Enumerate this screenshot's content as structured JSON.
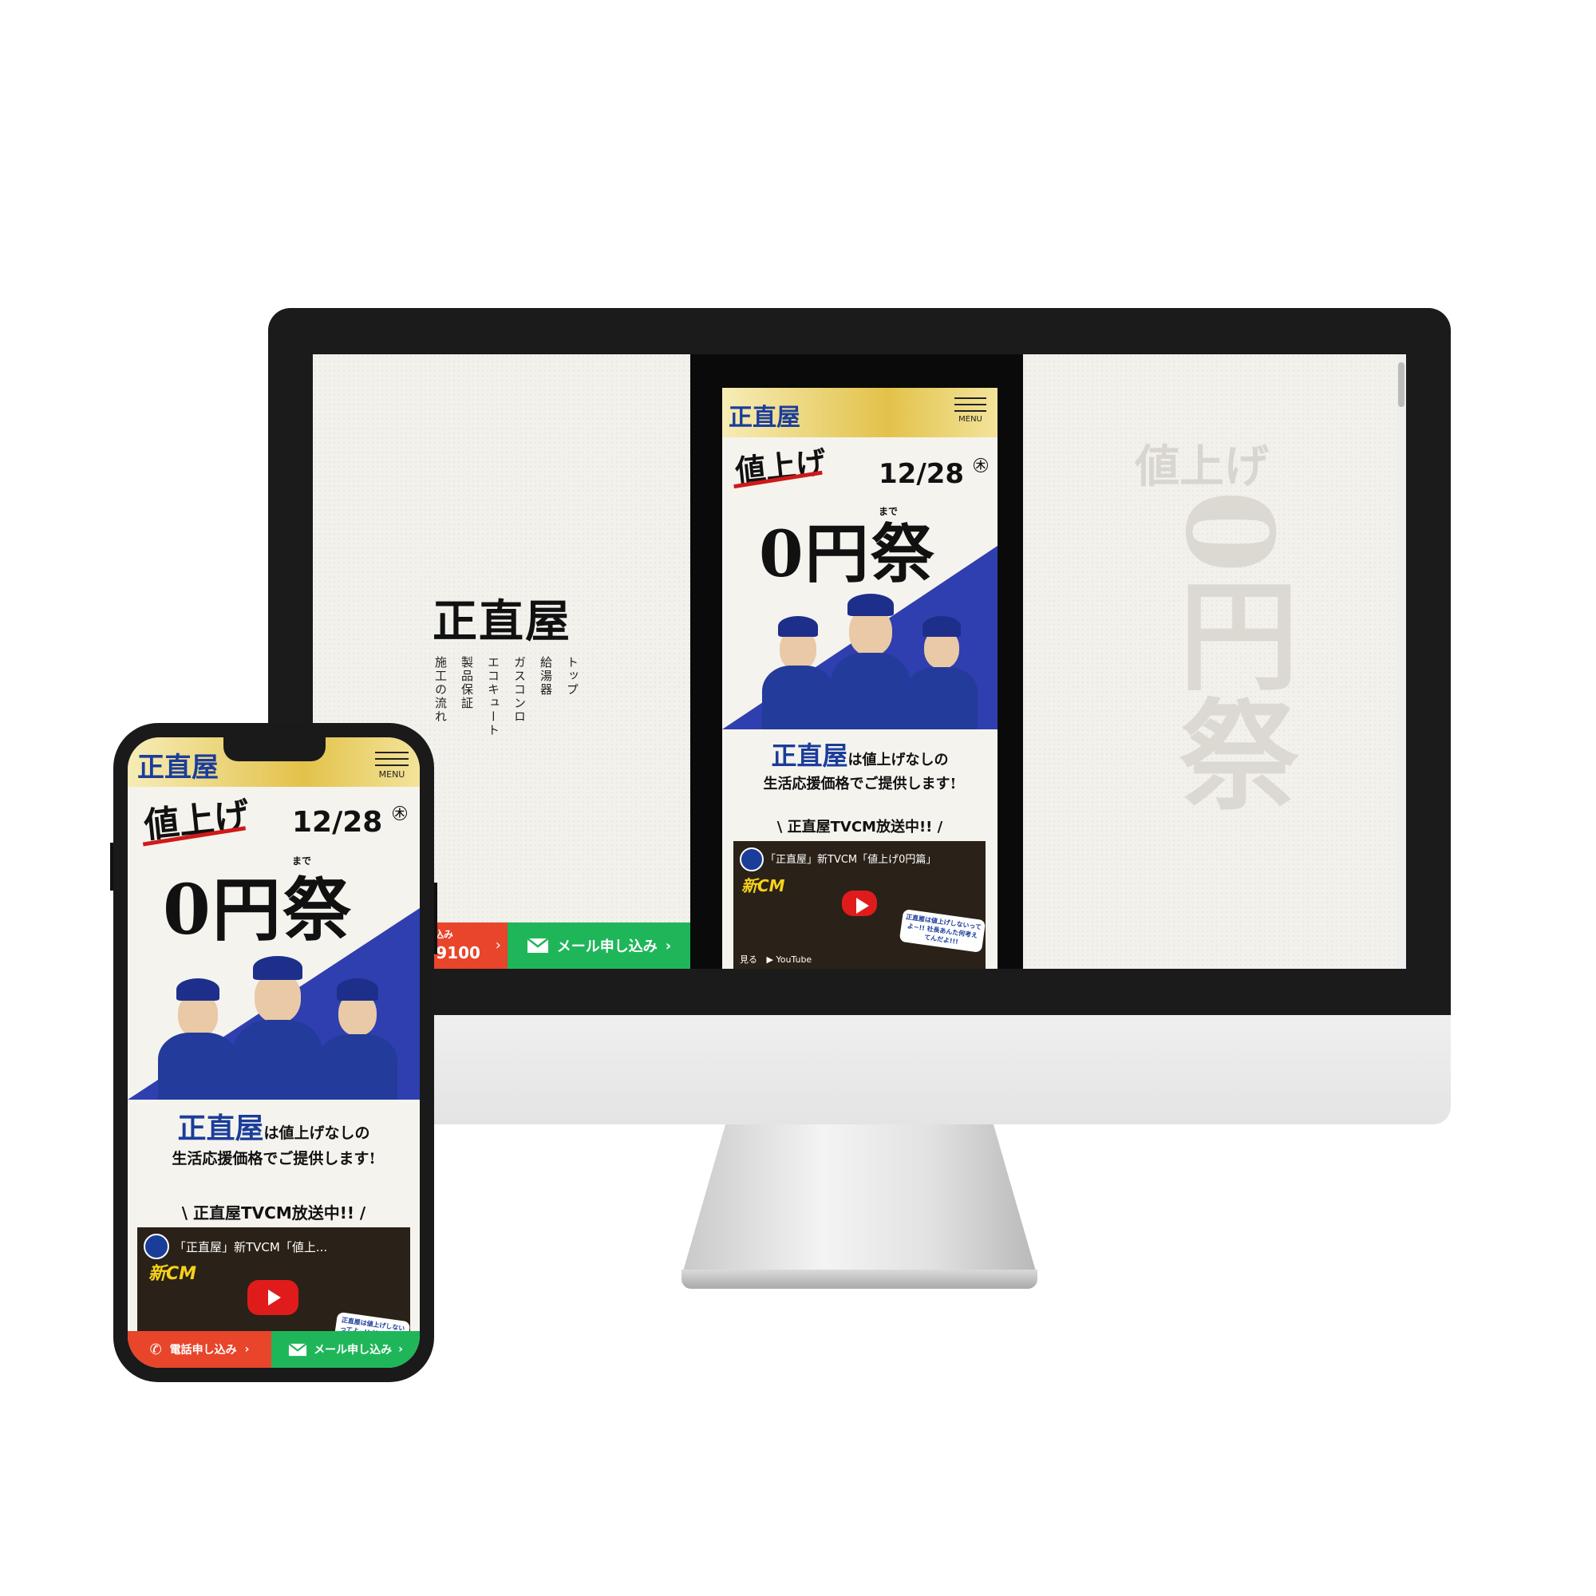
{
  "brand": {
    "logo_text": "正直屋"
  },
  "desktop_nav": [
    "トップ",
    "給湯器",
    "ガスコンロ",
    "エコキュート",
    "製品保証",
    "施工の流れ"
  ],
  "background_art": {
    "small": "値上げ",
    "big": "0円祭"
  },
  "desktop_cta_partial": {
    "tel_label": "込み",
    "tel_number": "-9100",
    "mail_label": "メール申し込み"
  },
  "header": {
    "menu_label": "MENU"
  },
  "hero": {
    "price_up": "値上げ",
    "date": "12/28",
    "weekday": "木",
    "until": "まで",
    "festival": "0円祭"
  },
  "tagline": {
    "brand": "正直屋",
    "line1_rest": "は値上げなしの",
    "line2": "生活応援価格でご提供します!"
  },
  "tvcm_heading": "\\ 正直屋TVCM放送中!! /",
  "video": {
    "title_desktop": "「正直屋」新TVCM「値上げ0円篇」",
    "title_mobile": "「正直屋」新TVCM「値上...",
    "new_cm": "新CM",
    "balloon": "正直屋は値上げしないってよ~!! 社長あんた何考えてんだよ!!!",
    "watch_on": "見る",
    "youtube": "YouTube"
  },
  "mobile_cta": {
    "tel_label": "電話申し込み",
    "mail_label": "メール申し込み"
  },
  "colors": {
    "accent_blue": "#1b3d9a",
    "tel_red": "#e8452b",
    "mail_green": "#1fb65a",
    "gold": "#e3c24a"
  }
}
